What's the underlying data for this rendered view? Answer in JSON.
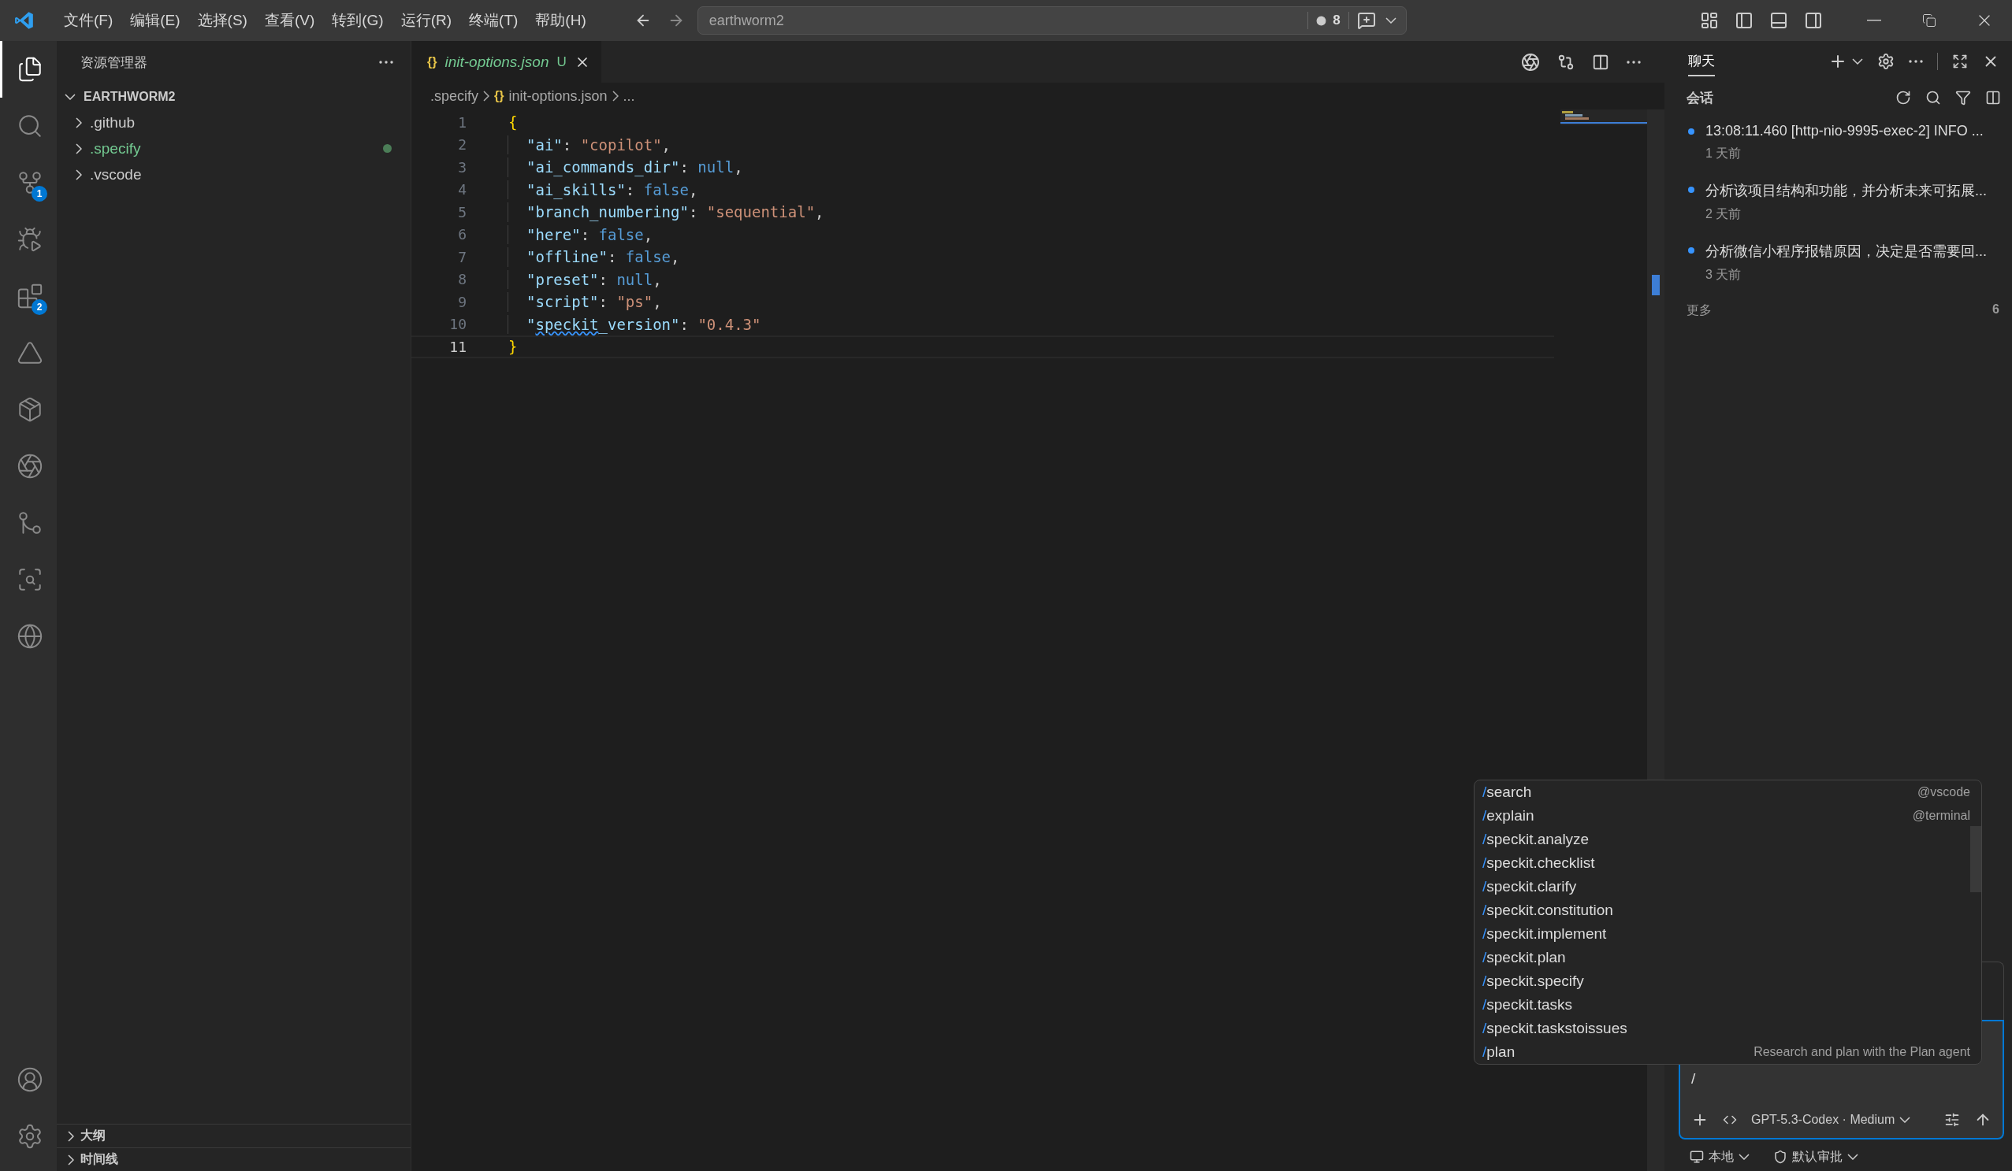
{
  "title_bar": {
    "menu": [
      "文件(F)",
      "编辑(E)",
      "选择(S)",
      "查看(V)",
      "转到(G)",
      "运行(R)",
      "终端(T)",
      "帮助(H)"
    ],
    "command_center": "earthworm2",
    "problems_count": "8"
  },
  "activity_bar": {
    "items": [
      {
        "kind": "explorer",
        "selected": true
      },
      {
        "kind": "search",
        "selected": false
      },
      {
        "kind": "source_control",
        "selected": false,
        "badge": "1"
      },
      {
        "kind": "run",
        "selected": false
      },
      {
        "kind": "extensions",
        "selected": false,
        "badge": "2"
      },
      {
        "kind": "triangle",
        "selected": false
      },
      {
        "kind": "package",
        "selected": false
      },
      {
        "kind": "knot",
        "selected": false
      },
      {
        "kind": "git_graph",
        "selected": false
      },
      {
        "kind": "git_search",
        "selected": false
      },
      {
        "kind": "globe",
        "selected": false
      }
    ],
    "bottom": [
      {
        "kind": "account"
      },
      {
        "kind": "settings"
      }
    ]
  },
  "sidebar": {
    "title": "资源管理器",
    "root": {
      "label": "EARTHWORM2",
      "expanded": true
    },
    "items": [
      {
        "label": ".github",
        "modified": false
      },
      {
        "label": ".specify",
        "modified": true
      },
      {
        "label": ".vscode",
        "modified": false
      }
    ],
    "sections": [
      {
        "label": "大纲",
        "expanded": false
      },
      {
        "label": "时间线",
        "expanded": false
      }
    ]
  },
  "editor": {
    "tabs": [
      {
        "icon": "{}",
        "label": "init-options.json",
        "status": "U",
        "selected": true
      }
    ],
    "breadcrumbs": [
      {
        "label": ".specify"
      },
      {
        "icon": "{}",
        "label": "init-options.json"
      },
      {
        "label": "..."
      }
    ],
    "lines": [
      {
        "number": "1",
        "current": false,
        "indented": false,
        "tokens": [
          {
            "kind": "brace",
            "text": "{"
          }
        ]
      },
      {
        "number": "2",
        "current": false,
        "indented": true,
        "tokens": [
          {
            "kind": "key",
            "text": "\"ai\""
          },
          {
            "kind": "punct",
            "text": ": "
          },
          {
            "kind": "string",
            "text": "\"copilot\""
          },
          {
            "kind": "punct",
            "text": ","
          }
        ]
      },
      {
        "number": "3",
        "current": false,
        "indented": true,
        "tokens": [
          {
            "kind": "key",
            "text": "\"ai_commands_dir\""
          },
          {
            "kind": "punct",
            "text": ": "
          },
          {
            "kind": "literal",
            "text": "null"
          },
          {
            "kind": "punct",
            "text": ","
          }
        ]
      },
      {
        "number": "4",
        "current": false,
        "indented": true,
        "tokens": [
          {
            "kind": "key",
            "text": "\"ai_skills\""
          },
          {
            "kind": "punct",
            "text": ": "
          },
          {
            "kind": "literal",
            "text": "false"
          },
          {
            "kind": "punct",
            "text": ","
          }
        ]
      },
      {
        "number": "5",
        "current": false,
        "indented": true,
        "tokens": [
          {
            "kind": "key",
            "text": "\"branch_numbering\""
          },
          {
            "kind": "punct",
            "text": ": "
          },
          {
            "kind": "string",
            "text": "\"sequential\""
          },
          {
            "kind": "punct",
            "text": ","
          }
        ]
      },
      {
        "number": "6",
        "current": false,
        "indented": true,
        "tokens": [
          {
            "kind": "key",
            "text": "\"here\""
          },
          {
            "kind": "punct",
            "text": ": "
          },
          {
            "kind": "literal",
            "text": "false"
          },
          {
            "kind": "punct",
            "text": ","
          }
        ]
      },
      {
        "number": "7",
        "current": false,
        "indented": true,
        "tokens": [
          {
            "kind": "key",
            "text": "\"offline\""
          },
          {
            "kind": "punct",
            "text": ": "
          },
          {
            "kind": "literal",
            "text": "false"
          },
          {
            "kind": "punct",
            "text": ","
          }
        ]
      },
      {
        "number": "8",
        "current": false,
        "indented": true,
        "tokens": [
          {
            "kind": "key",
            "text": "\"preset\""
          },
          {
            "kind": "punct",
            "text": ": "
          },
          {
            "kind": "literal",
            "text": "null"
          },
          {
            "kind": "punct",
            "text": ","
          }
        ]
      },
      {
        "number": "9",
        "current": false,
        "indented": true,
        "tokens": [
          {
            "kind": "key",
            "text": "\"script\""
          },
          {
            "kind": "punct",
            "text": ": "
          },
          {
            "kind": "string",
            "text": "\"ps\""
          },
          {
            "kind": "punct",
            "text": ","
          }
        ]
      },
      {
        "number": "10",
        "current": false,
        "indented": true,
        "tokens": [
          {
            "kind": "key",
            "text": "\""
          },
          {
            "kind": "key",
            "text": "speckit",
            "warning": true
          },
          {
            "kind": "key",
            "text": "_version\""
          },
          {
            "kind": "punct",
            "text": ": "
          },
          {
            "kind": "string",
            "text": "\"0.4.3\""
          }
        ]
      },
      {
        "number": "11",
        "current": true,
        "indented": false,
        "tokens": [
          {
            "kind": "brace",
            "text": "}"
          }
        ]
      }
    ]
  },
  "chat": {
    "tabs": [
      {
        "label": "聊天",
        "selected": true
      }
    ],
    "section_title": "会话",
    "sessions": [
      {
        "title": "13:08:11.460 [http-nio-9995-exec-2] INFO ...",
        "time": "1 天前",
        "unread": true
      },
      {
        "title": "分析该项目结构和功能，并分析未来可拓展...",
        "time": "2 天前",
        "unread": true
      },
      {
        "title": "分析微信小程序报错原因，决定是否需要回...",
        "time": "3 天前",
        "unread": true
      }
    ],
    "more": {
      "label": "更多",
      "count": "6"
    },
    "input": {
      "value": "/"
    },
    "model": "GPT-5.3-Codex · Medium",
    "footer": [
      {
        "kind": "computer",
        "label": "本地"
      },
      {
        "kind": "shield",
        "label": "默认审批"
      }
    ]
  },
  "command_menu": {
    "items": [
      {
        "command": "/search",
        "hint": "@vscode"
      },
      {
        "command": "/explain",
        "hint": "@terminal"
      },
      {
        "command": "/speckit.analyze"
      },
      {
        "command": "/speckit.checklist"
      },
      {
        "command": "/speckit.clarify"
      },
      {
        "command": "/speckit.constitution"
      },
      {
        "command": "/speckit.implement"
      },
      {
        "command": "/speckit.plan"
      },
      {
        "command": "/speckit.specify"
      },
      {
        "command": "/speckit.tasks"
      },
      {
        "command": "/speckit.taskstoissues"
      },
      {
        "command": "/plan",
        "hint": "Research and plan with the Plan agent"
      }
    ]
  }
}
